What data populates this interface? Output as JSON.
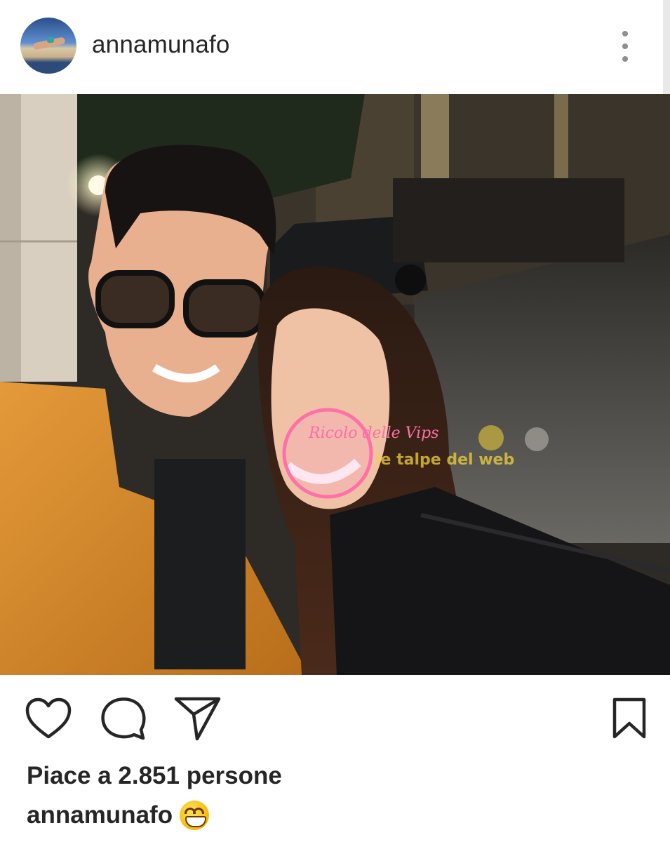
{
  "post": {
    "username": "annamunafo",
    "avatar_icon": "profile-avatar",
    "more_icon": "more-vertical-icon"
  },
  "photo": {
    "alt": "selfie-photo",
    "watermark": {
      "circle_text": "Ricolo delle Vips",
      "band_text": "le talpe del web"
    }
  },
  "actions": {
    "like_icon": "heart-icon",
    "comment_icon": "comment-icon",
    "share_icon": "send-icon",
    "save_icon": "bookmark-icon"
  },
  "likes_text": "Piace a 2.851 persone",
  "caption": {
    "username": "annamunafo",
    "emoji": "grinning-face-emoji"
  },
  "colors": {
    "text": "#262626",
    "muted": "#8e8e8e",
    "jacket": "#d98a2e",
    "watermark_pink": "#ff6fa8",
    "watermark_yellow": "#f3d13a"
  }
}
